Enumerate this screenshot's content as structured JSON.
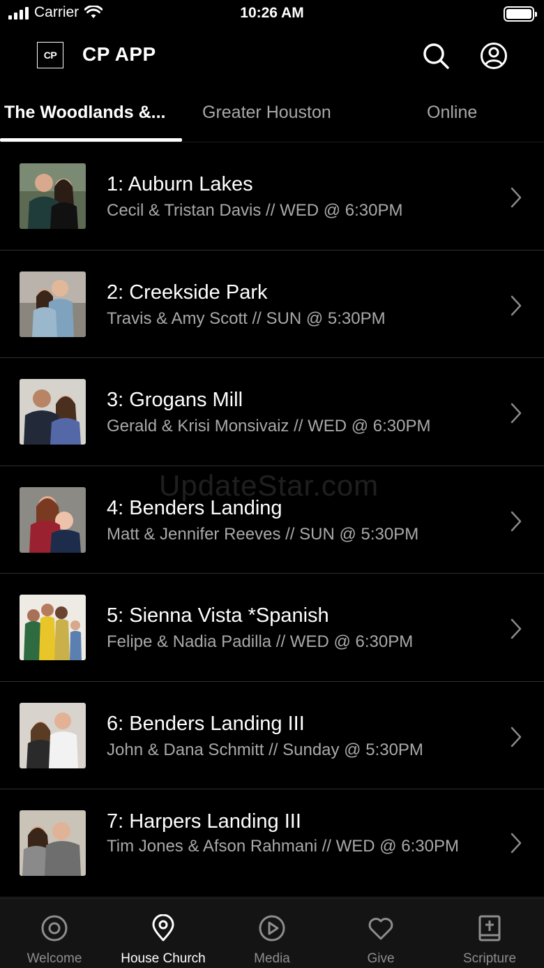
{
  "status_bar": {
    "carrier": "Carrier",
    "time": "10:26 AM"
  },
  "header": {
    "logo_text": "CP",
    "title": "CP APP"
  },
  "tabs": [
    {
      "label": "The Woodlands &...",
      "active": true
    },
    {
      "label": "Greater Houston",
      "active": false
    },
    {
      "label": "Online",
      "active": false
    }
  ],
  "churches": [
    {
      "title": "1: Auburn Lakes",
      "subtitle": "Cecil & Tristan Davis // WED @ 6:30PM"
    },
    {
      "title": "2: Creekside Park",
      "subtitle": "Travis & Amy Scott // SUN @ 5:30PM"
    },
    {
      "title": "3: Grogans Mill",
      "subtitle": "Gerald & Krisi Monsivaiz // WED @ 6:30PM"
    },
    {
      "title": "4: Benders Landing",
      "subtitle": "Matt & Jennifer Reeves // SUN @ 5:30PM"
    },
    {
      "title": "5: Sienna Vista *Spanish",
      "subtitle": "Felipe & Nadia Padilla // WED @ 6:30PM"
    },
    {
      "title": "6: Benders Landing III",
      "subtitle": "John & Dana Schmitt // Sunday @ 5:30PM"
    },
    {
      "title": "7: Harpers Landing III",
      "subtitle": "Tim Jones & Afson Rahmani // WED @ 6:30PM"
    }
  ],
  "watermark": "UpdateStar.com",
  "tabbar": [
    {
      "label": "Welcome",
      "icon": "target-icon",
      "active": false
    },
    {
      "label": "House Church",
      "icon": "location-pin-icon",
      "active": true
    },
    {
      "label": "Media",
      "icon": "play-circle-icon",
      "active": false
    },
    {
      "label": "Give",
      "icon": "heart-icon",
      "active": false
    },
    {
      "label": "Scripture",
      "icon": "bible-icon",
      "active": false
    }
  ],
  "colors": {
    "background": "#000000",
    "primary_text": "#ffffff",
    "secondary_text": "#a9a9a9",
    "inactive_tab": "#8e8e8e",
    "divider": "#2e2e2e"
  }
}
